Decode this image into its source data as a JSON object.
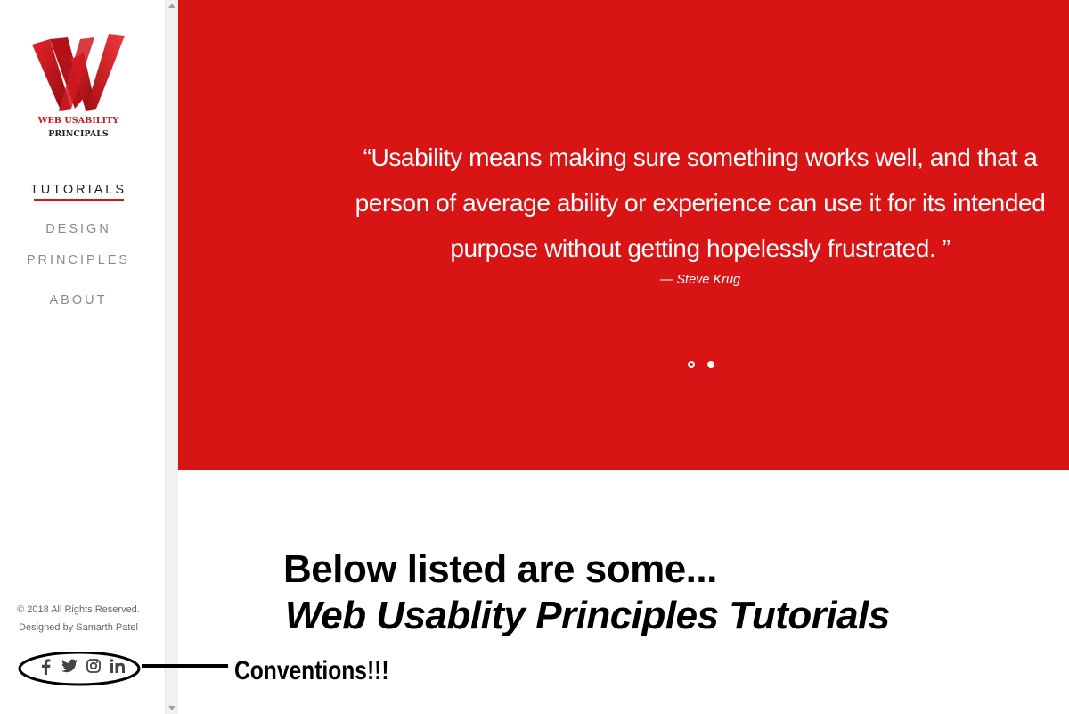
{
  "logo": {
    "line1": "WEB USABILITY",
    "line2": "PRINCIPALS",
    "colors": {
      "red": "#d81414",
      "dark": "#8b0b10"
    }
  },
  "nav": {
    "items": [
      {
        "label": "TUTORIALS",
        "active": true
      },
      {
        "label": "DESIGN"
      },
      {
        "label": "PRINCIPLES"
      },
      {
        "label": "ABOUT"
      }
    ]
  },
  "footer": {
    "copyright": "© 2018 All Rights Reserved.",
    "designer": "Designed by Samarth Patel",
    "social": [
      {
        "icon": "facebook-icon",
        "glyph": "f"
      },
      {
        "icon": "twitter-icon",
        "glyph": "t"
      },
      {
        "icon": "instagram-icon",
        "glyph": "ig"
      },
      {
        "icon": "linkedin-icon",
        "glyph": "in"
      }
    ]
  },
  "hero": {
    "background": "#d81414",
    "quote_line1": "“Usability means making sure something works well, and that a",
    "quote_line2": "person of average ability or experience can use it for its intended",
    "quote_line3": "purpose without getting hopelessly frustrated. ”",
    "author": "— Steve Krug",
    "slides": {
      "count": 2,
      "active_index": 1
    }
  },
  "content": {
    "heading_line1": "Below listed are some...",
    "heading_line2": "Web Usablity Principles Tutorials"
  },
  "annotation": {
    "text": "Conventions!!!"
  }
}
